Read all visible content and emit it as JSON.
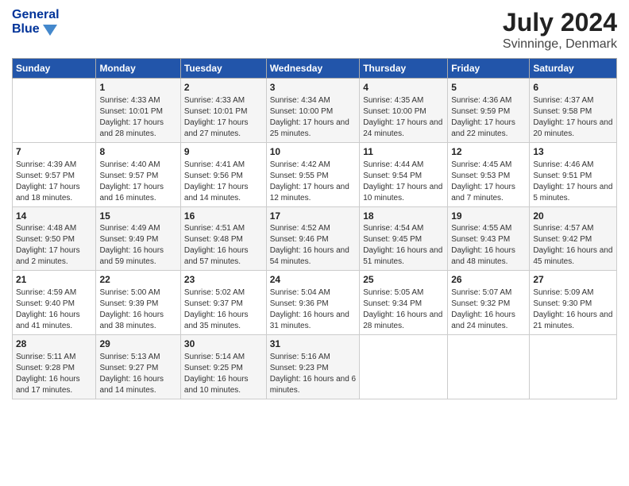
{
  "header": {
    "logo_line1": "General",
    "logo_line2": "Blue",
    "title": "July 2024",
    "subtitle": "Svinninge, Denmark"
  },
  "weekdays": [
    "Sunday",
    "Monday",
    "Tuesday",
    "Wednesday",
    "Thursday",
    "Friday",
    "Saturday"
  ],
  "weeks": [
    [
      {
        "day": "",
        "info": ""
      },
      {
        "day": "1",
        "sunrise": "Sunrise: 4:33 AM",
        "sunset": "Sunset: 10:01 PM",
        "daylight": "Daylight: 17 hours and 28 minutes."
      },
      {
        "day": "2",
        "sunrise": "Sunrise: 4:33 AM",
        "sunset": "Sunset: 10:01 PM",
        "daylight": "Daylight: 17 hours and 27 minutes."
      },
      {
        "day": "3",
        "sunrise": "Sunrise: 4:34 AM",
        "sunset": "Sunset: 10:00 PM",
        "daylight": "Daylight: 17 hours and 25 minutes."
      },
      {
        "day": "4",
        "sunrise": "Sunrise: 4:35 AM",
        "sunset": "Sunset: 10:00 PM",
        "daylight": "Daylight: 17 hours and 24 minutes."
      },
      {
        "day": "5",
        "sunrise": "Sunrise: 4:36 AM",
        "sunset": "Sunset: 9:59 PM",
        "daylight": "Daylight: 17 hours and 22 minutes."
      },
      {
        "day": "6",
        "sunrise": "Sunrise: 4:37 AM",
        "sunset": "Sunset: 9:58 PM",
        "daylight": "Daylight: 17 hours and 20 minutes."
      }
    ],
    [
      {
        "day": "7",
        "sunrise": "Sunrise: 4:39 AM",
        "sunset": "Sunset: 9:57 PM",
        "daylight": "Daylight: 17 hours and 18 minutes."
      },
      {
        "day": "8",
        "sunrise": "Sunrise: 4:40 AM",
        "sunset": "Sunset: 9:57 PM",
        "daylight": "Daylight: 17 hours and 16 minutes."
      },
      {
        "day": "9",
        "sunrise": "Sunrise: 4:41 AM",
        "sunset": "Sunset: 9:56 PM",
        "daylight": "Daylight: 17 hours and 14 minutes."
      },
      {
        "day": "10",
        "sunrise": "Sunrise: 4:42 AM",
        "sunset": "Sunset: 9:55 PM",
        "daylight": "Daylight: 17 hours and 12 minutes."
      },
      {
        "day": "11",
        "sunrise": "Sunrise: 4:44 AM",
        "sunset": "Sunset: 9:54 PM",
        "daylight": "Daylight: 17 hours and 10 minutes."
      },
      {
        "day": "12",
        "sunrise": "Sunrise: 4:45 AM",
        "sunset": "Sunset: 9:53 PM",
        "daylight": "Daylight: 17 hours and 7 minutes."
      },
      {
        "day": "13",
        "sunrise": "Sunrise: 4:46 AM",
        "sunset": "Sunset: 9:51 PM",
        "daylight": "Daylight: 17 hours and 5 minutes."
      }
    ],
    [
      {
        "day": "14",
        "sunrise": "Sunrise: 4:48 AM",
        "sunset": "Sunset: 9:50 PM",
        "daylight": "Daylight: 17 hours and 2 minutes."
      },
      {
        "day": "15",
        "sunrise": "Sunrise: 4:49 AM",
        "sunset": "Sunset: 9:49 PM",
        "daylight": "Daylight: 16 hours and 59 minutes."
      },
      {
        "day": "16",
        "sunrise": "Sunrise: 4:51 AM",
        "sunset": "Sunset: 9:48 PM",
        "daylight": "Daylight: 16 hours and 57 minutes."
      },
      {
        "day": "17",
        "sunrise": "Sunrise: 4:52 AM",
        "sunset": "Sunset: 9:46 PM",
        "daylight": "Daylight: 16 hours and 54 minutes."
      },
      {
        "day": "18",
        "sunrise": "Sunrise: 4:54 AM",
        "sunset": "Sunset: 9:45 PM",
        "daylight": "Daylight: 16 hours and 51 minutes."
      },
      {
        "day": "19",
        "sunrise": "Sunrise: 4:55 AM",
        "sunset": "Sunset: 9:43 PM",
        "daylight": "Daylight: 16 hours and 48 minutes."
      },
      {
        "day": "20",
        "sunrise": "Sunrise: 4:57 AM",
        "sunset": "Sunset: 9:42 PM",
        "daylight": "Daylight: 16 hours and 45 minutes."
      }
    ],
    [
      {
        "day": "21",
        "sunrise": "Sunrise: 4:59 AM",
        "sunset": "Sunset: 9:40 PM",
        "daylight": "Daylight: 16 hours and 41 minutes."
      },
      {
        "day": "22",
        "sunrise": "Sunrise: 5:00 AM",
        "sunset": "Sunset: 9:39 PM",
        "daylight": "Daylight: 16 hours and 38 minutes."
      },
      {
        "day": "23",
        "sunrise": "Sunrise: 5:02 AM",
        "sunset": "Sunset: 9:37 PM",
        "daylight": "Daylight: 16 hours and 35 minutes."
      },
      {
        "day": "24",
        "sunrise": "Sunrise: 5:04 AM",
        "sunset": "Sunset: 9:36 PM",
        "daylight": "Daylight: 16 hours and 31 minutes."
      },
      {
        "day": "25",
        "sunrise": "Sunrise: 5:05 AM",
        "sunset": "Sunset: 9:34 PM",
        "daylight": "Daylight: 16 hours and 28 minutes."
      },
      {
        "day": "26",
        "sunrise": "Sunrise: 5:07 AM",
        "sunset": "Sunset: 9:32 PM",
        "daylight": "Daylight: 16 hours and 24 minutes."
      },
      {
        "day": "27",
        "sunrise": "Sunrise: 5:09 AM",
        "sunset": "Sunset: 9:30 PM",
        "daylight": "Daylight: 16 hours and 21 minutes."
      }
    ],
    [
      {
        "day": "28",
        "sunrise": "Sunrise: 5:11 AM",
        "sunset": "Sunset: 9:28 PM",
        "daylight": "Daylight: 16 hours and 17 minutes."
      },
      {
        "day": "29",
        "sunrise": "Sunrise: 5:13 AM",
        "sunset": "Sunset: 9:27 PM",
        "daylight": "Daylight: 16 hours and 14 minutes."
      },
      {
        "day": "30",
        "sunrise": "Sunrise: 5:14 AM",
        "sunset": "Sunset: 9:25 PM",
        "daylight": "Daylight: 16 hours and 10 minutes."
      },
      {
        "day": "31",
        "sunrise": "Sunrise: 5:16 AM",
        "sunset": "Sunset: 9:23 PM",
        "daylight": "Daylight: 16 hours and 6 minutes."
      },
      {
        "day": "",
        "info": ""
      },
      {
        "day": "",
        "info": ""
      },
      {
        "day": "",
        "info": ""
      }
    ]
  ]
}
